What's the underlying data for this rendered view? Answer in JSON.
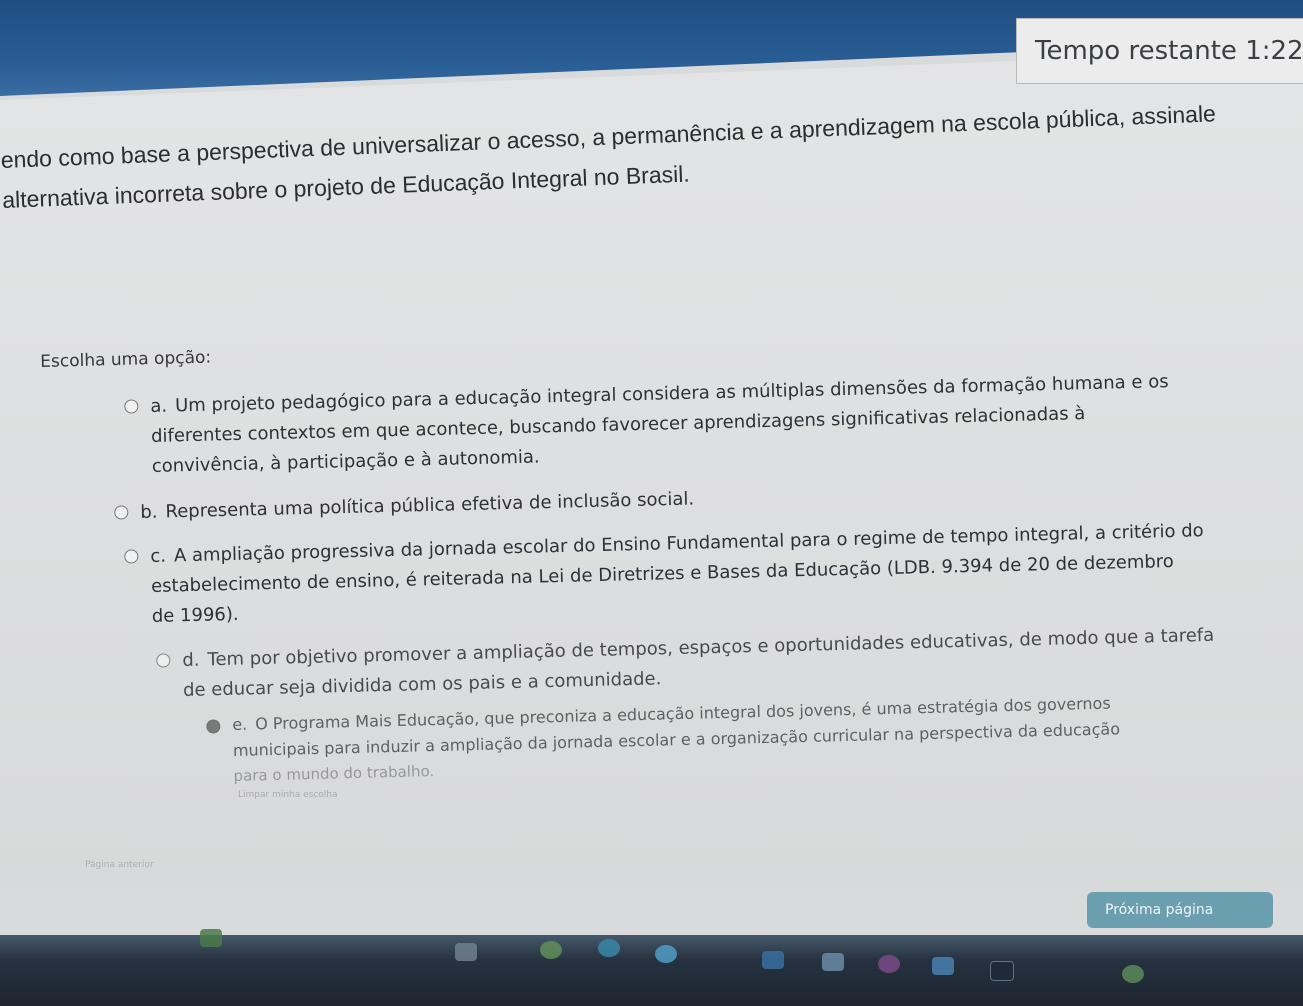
{
  "timer": {
    "label": "Tempo restante",
    "value": "1:22"
  },
  "question": {
    "line1": "endo como base a perspectiva de universalizar o acesso, a permanência e a aprendizagem na escola pública, assinale",
    "line2": "alternativa incorreta sobre o projeto de Educação Integral no Brasil."
  },
  "choose_label": "Escolha uma opção:",
  "options": [
    {
      "letter": "a.",
      "lines": [
        "Um projeto pedagógico para a educação integral considera as múltiplas dimensões da formação humana e os",
        "diferentes contextos em que acontece, buscando favorecer aprendizagens significativas relacionadas à",
        "convivência, à participação e à autonomia."
      ],
      "selected": false
    },
    {
      "letter": "b.",
      "lines": [
        "Representa uma política pública efetiva de inclusão social."
      ],
      "selected": false
    },
    {
      "letter": "c.",
      "lines": [
        "A ampliação progressiva da jornada escolar do Ensino Fundamental para o regime de tempo integral, a critério do",
        "estabelecimento de ensino, é reiterada na Lei de Diretrizes e Bases da Educação (LDB. 9.394 de 20 de dezembro",
        "de 1996)."
      ],
      "selected": false
    },
    {
      "letter": "d.",
      "lines": [
        "Tem por objetivo promover a ampliação de tempos, espaços e oportunidades educativas, de modo que a tarefa",
        "de educar seja dividida com os pais e a comunidade."
      ],
      "selected": false
    },
    {
      "letter": "e.",
      "lines": [
        "O Programa Mais Educação, que preconiza a educação integral dos jovens, é uma estratégia dos governos",
        "municipais para induzir a ampliação da jornada escolar e a organização curricular na perspectiva da educação",
        "para o mundo do trabalho."
      ],
      "selected": true
    }
  ],
  "clear_choice": "Limpar minha escolha",
  "prev_page": "Página anterior",
  "next_button": "Próxima página",
  "taskbar": {
    "icons": [
      "browser-icon",
      "file-explorer-icon",
      "chrome-icon",
      "edge-icon",
      "mail-icon",
      "store-icon",
      "photos-icon",
      "media-icon",
      "terminal-icon",
      "tray-network-icon",
      "tray-volume-icon"
    ]
  }
}
